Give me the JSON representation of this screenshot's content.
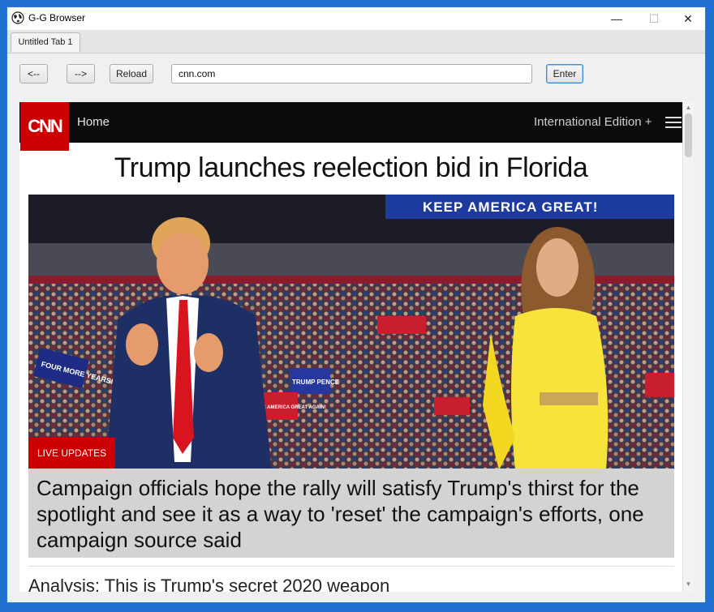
{
  "window": {
    "title": "G-G Browser",
    "icon": "globe-icon"
  },
  "tabs": [
    {
      "label": "Untitled Tab 1"
    }
  ],
  "toolbar": {
    "back_label": "<--",
    "forward_label": "-->",
    "reload_label": "Reload",
    "url_value": "cnn.com",
    "enter_label": "Enter"
  },
  "page": {
    "nav": {
      "logo": "CNN",
      "home": "Home",
      "edition": "International Edition +"
    },
    "headline": "Trump launches reelection bid in Florida",
    "hero": {
      "banner_text": "KEEP AMERICA GREAT!",
      "sign_1": "FOUR MORE YEARS!",
      "sign_2": "TRUMP PENCE",
      "sign_3": "MAKE AMERICA GREAT AGAIN!"
    },
    "badge": "LIVE UPDATES",
    "caption": "Campaign officials hope the rally will satisfy Trump's thirst for the spotlight and see it as a way to 'reset' the campaign's efforts, one campaign source said",
    "next_headline": "Analysis: This is Trump's secret 2020 weapon"
  },
  "colors": {
    "cnn_red": "#cc0000",
    "nav_bg": "#0c0c0c",
    "window_border": "#2a7bd8"
  }
}
